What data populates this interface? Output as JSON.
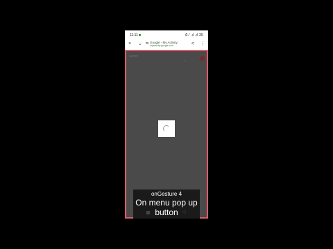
{
  "status_bar": {
    "time": "11:11",
    "icons": "⏱ ⁄ .ıl .ıl 35"
  },
  "browser": {
    "close_icon": "×",
    "chevron_icon": "⌄",
    "tune_icon": "⇆",
    "page_title": "Google - My Activity",
    "url_host": "myactivity.google.com",
    "share_icon": "<",
    "menu_icon": "⋮"
  },
  "content": {
    "header_title": "Activity"
  },
  "overlay": {
    "small_caption": "onGesture 4",
    "large_caption": "On menu pop up button"
  }
}
